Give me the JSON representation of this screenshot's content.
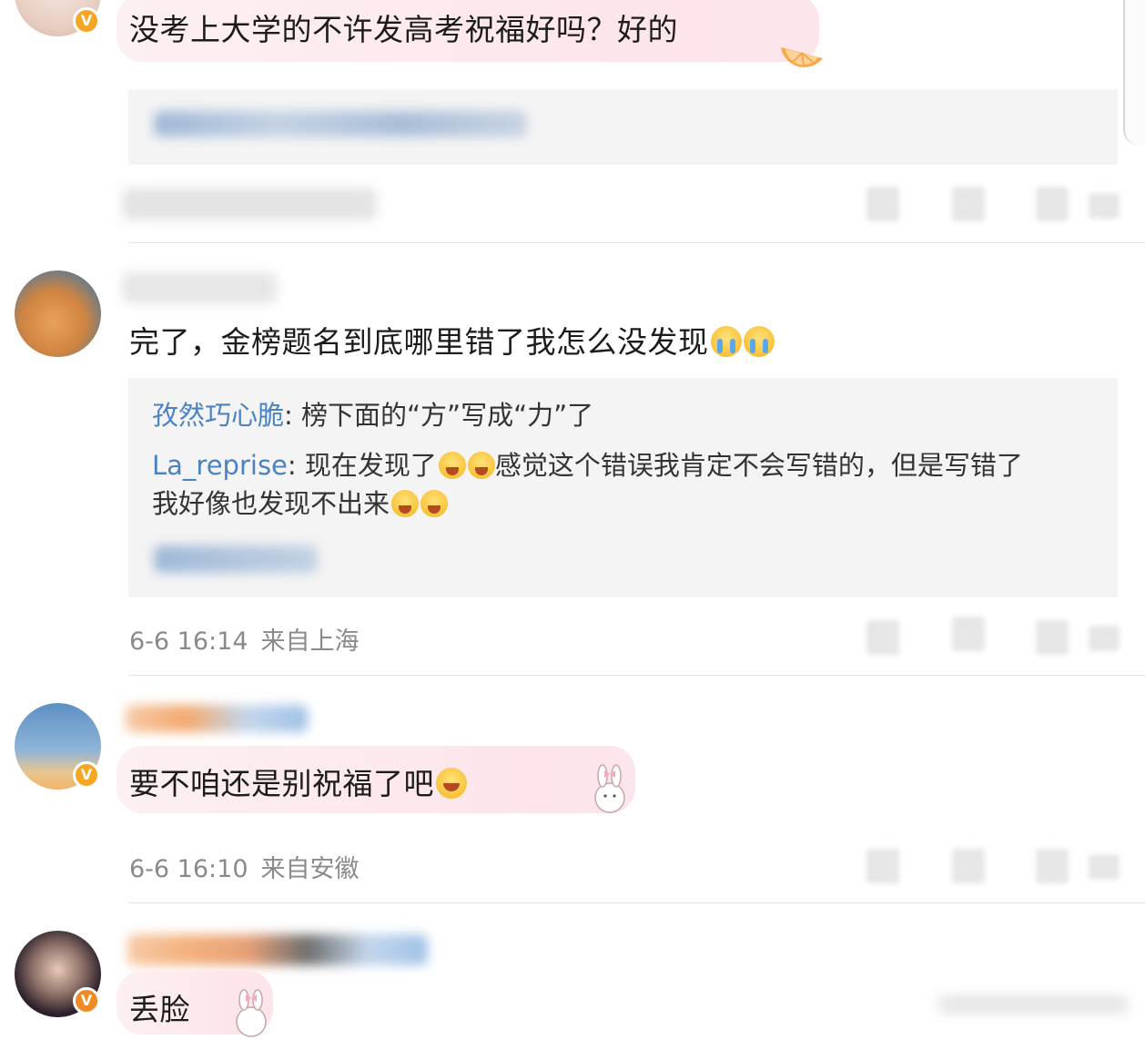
{
  "comments": [
    {
      "text": "没考上大学的不许发高考祝福好吗？好的",
      "verified": true,
      "bubble_sticker": "orange-slice"
    },
    {
      "text": "完了，金榜题名到底哪里错了我怎么没发现",
      "verified": false,
      "emojis": [
        "crying-emoji",
        "crying-emoji"
      ],
      "replies": [
        {
          "name": "孜然巧心脆",
          "sep": ": ",
          "text": "榜下面的“方”写成“力”了"
        },
        {
          "name": "La_reprise",
          "sep": ": ",
          "text_a": "现在发现了",
          "text_b": "感觉这个错误我肯定不会写错的，但是写错了",
          "text_c": "我好像也发现不出来"
        }
      ],
      "timestamp": "6-6 16:14",
      "location": "来自上海"
    },
    {
      "text": "要不咱还是别祝福了吧",
      "verified": true,
      "emojis": [
        "laughing-emoji"
      ],
      "timestamp": "6-6 16:10",
      "location": "来自安徽"
    },
    {
      "text": "丢脸",
      "verified": true,
      "bubble_sticker": "bunny"
    }
  ],
  "icons": {
    "verified": "V",
    "colors": {
      "verified": "#f6a623",
      "reply_name": "#4b82c2",
      "meta": "#8a8a8a"
    }
  }
}
